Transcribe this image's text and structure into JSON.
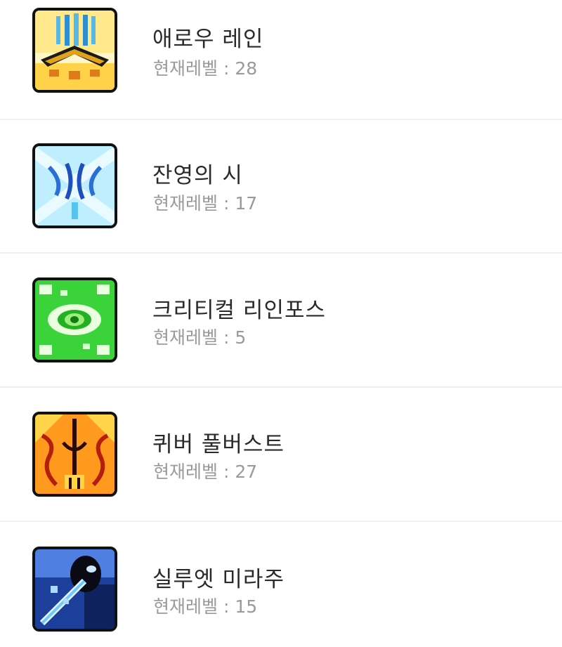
{
  "level_prefix": "현재레벨 : ",
  "skills": [
    {
      "name": "애로우 레인",
      "level": "28",
      "icon": "arrow-rain-icon"
    },
    {
      "name": "잔영의 시",
      "level": "17",
      "icon": "afterimage-arrow-icon"
    },
    {
      "name": "크리티컬 리인포스",
      "level": "5",
      "icon": "critical-reinforce-icon"
    },
    {
      "name": "퀴버 풀버스트",
      "level": "27",
      "icon": "quiver-full-burst-icon"
    },
    {
      "name": "실루엣 미라주",
      "level": "15",
      "icon": "silhouette-mirage-icon"
    }
  ]
}
